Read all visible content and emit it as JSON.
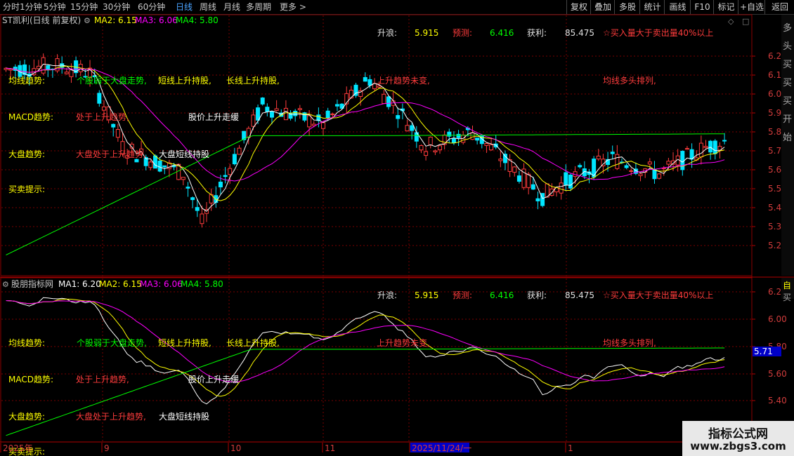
{
  "toolbar": {
    "timeframes": [
      "分时",
      "1分钟",
      "5分钟",
      "15分钟",
      "30分钟",
      "60分钟",
      "日线",
      "周线",
      "月线",
      "多周期",
      "更多 >"
    ],
    "active_timeframe": "日线",
    "buttons": [
      "复权",
      "叠加",
      "多股",
      "统计",
      "画线",
      "F10",
      "标记",
      "+自选",
      "返回"
    ]
  },
  "main_panel": {
    "title": "ST凯利(日线 前复权)",
    "ma_values": [
      {
        "label": "MA2: 6.15",
        "color": "#ffff00"
      },
      {
        "label": "MA3: 6.06",
        "color": "#ff00ff"
      },
      {
        "label": "MA4: 5.80",
        "color": "#00ff00"
      }
    ],
    "price_ticks": [
      "6.20",
      "6.10",
      "6.00",
      "5.90",
      "5.80",
      "5.70",
      "5.60",
      "5.50",
      "5.40",
      "5.30",
      "5.20"
    ],
    "right_strip": "多头买买买开始"
  },
  "indicator_panel": {
    "title": "股朋指标网",
    "ma_values": [
      {
        "label": "MA1: 6.20",
        "color": "#ffffff"
      },
      {
        "label": "MA2: 6.15",
        "color": "#ffff00"
      },
      {
        "label": "MA3: 6.06",
        "color": "#ff00ff"
      },
      {
        "label": "MA4: 5.80",
        "color": "#00ff00"
      }
    ],
    "price_ticks": [
      "6.20",
      "6.00",
      "5.80",
      "5.60",
      "5.40"
    ],
    "current_price": "5.71",
    "right_strip": "自买"
  },
  "annotations": {
    "rise": "升浪:",
    "rise_value": "5.915",
    "forecast": "预测:",
    "forecast_value": "6.416",
    "profit": "获利:",
    "profit_value": "85.475",
    "volume_note": "☆买入量大于卖出量40%以上",
    "ma_trend": "均线趋势:",
    "macd_trend": "MACD趋势:",
    "market_trend": "大盘趋势:",
    "trade_hint": "买卖提示:",
    "weak_vs_market": "个股弱于大盘走势,",
    "short_rise": "短线上升持股,",
    "long_rise": "长线上升持股,",
    "rise_unchanged": "上升趋势未变,",
    "bull_alignment": "均线多头排列,",
    "macd_rising": "处于上升趋势,",
    "price_slow_rise": "股价上升走缓",
    "market_rising": "大盘处于上升趋势,",
    "market_short_hold": "大盘短线持股"
  },
  "x_axis": {
    "labels": [
      "2025年",
      "9",
      "10",
      "11",
      "2025/11/24/一",
      "1"
    ],
    "highlight": "2025/11/24/一"
  },
  "watermark": {
    "line1": "指标公式网",
    "line2": "www.zbgs3.com"
  },
  "colors": {
    "up": "#ff3c3c",
    "down": "#00e5ff",
    "grid": "#7a0000",
    "ma1": "#ffffff",
    "ma2": "#ffff00",
    "ma3": "#ff00ff",
    "ma4": "#00ff00"
  }
}
